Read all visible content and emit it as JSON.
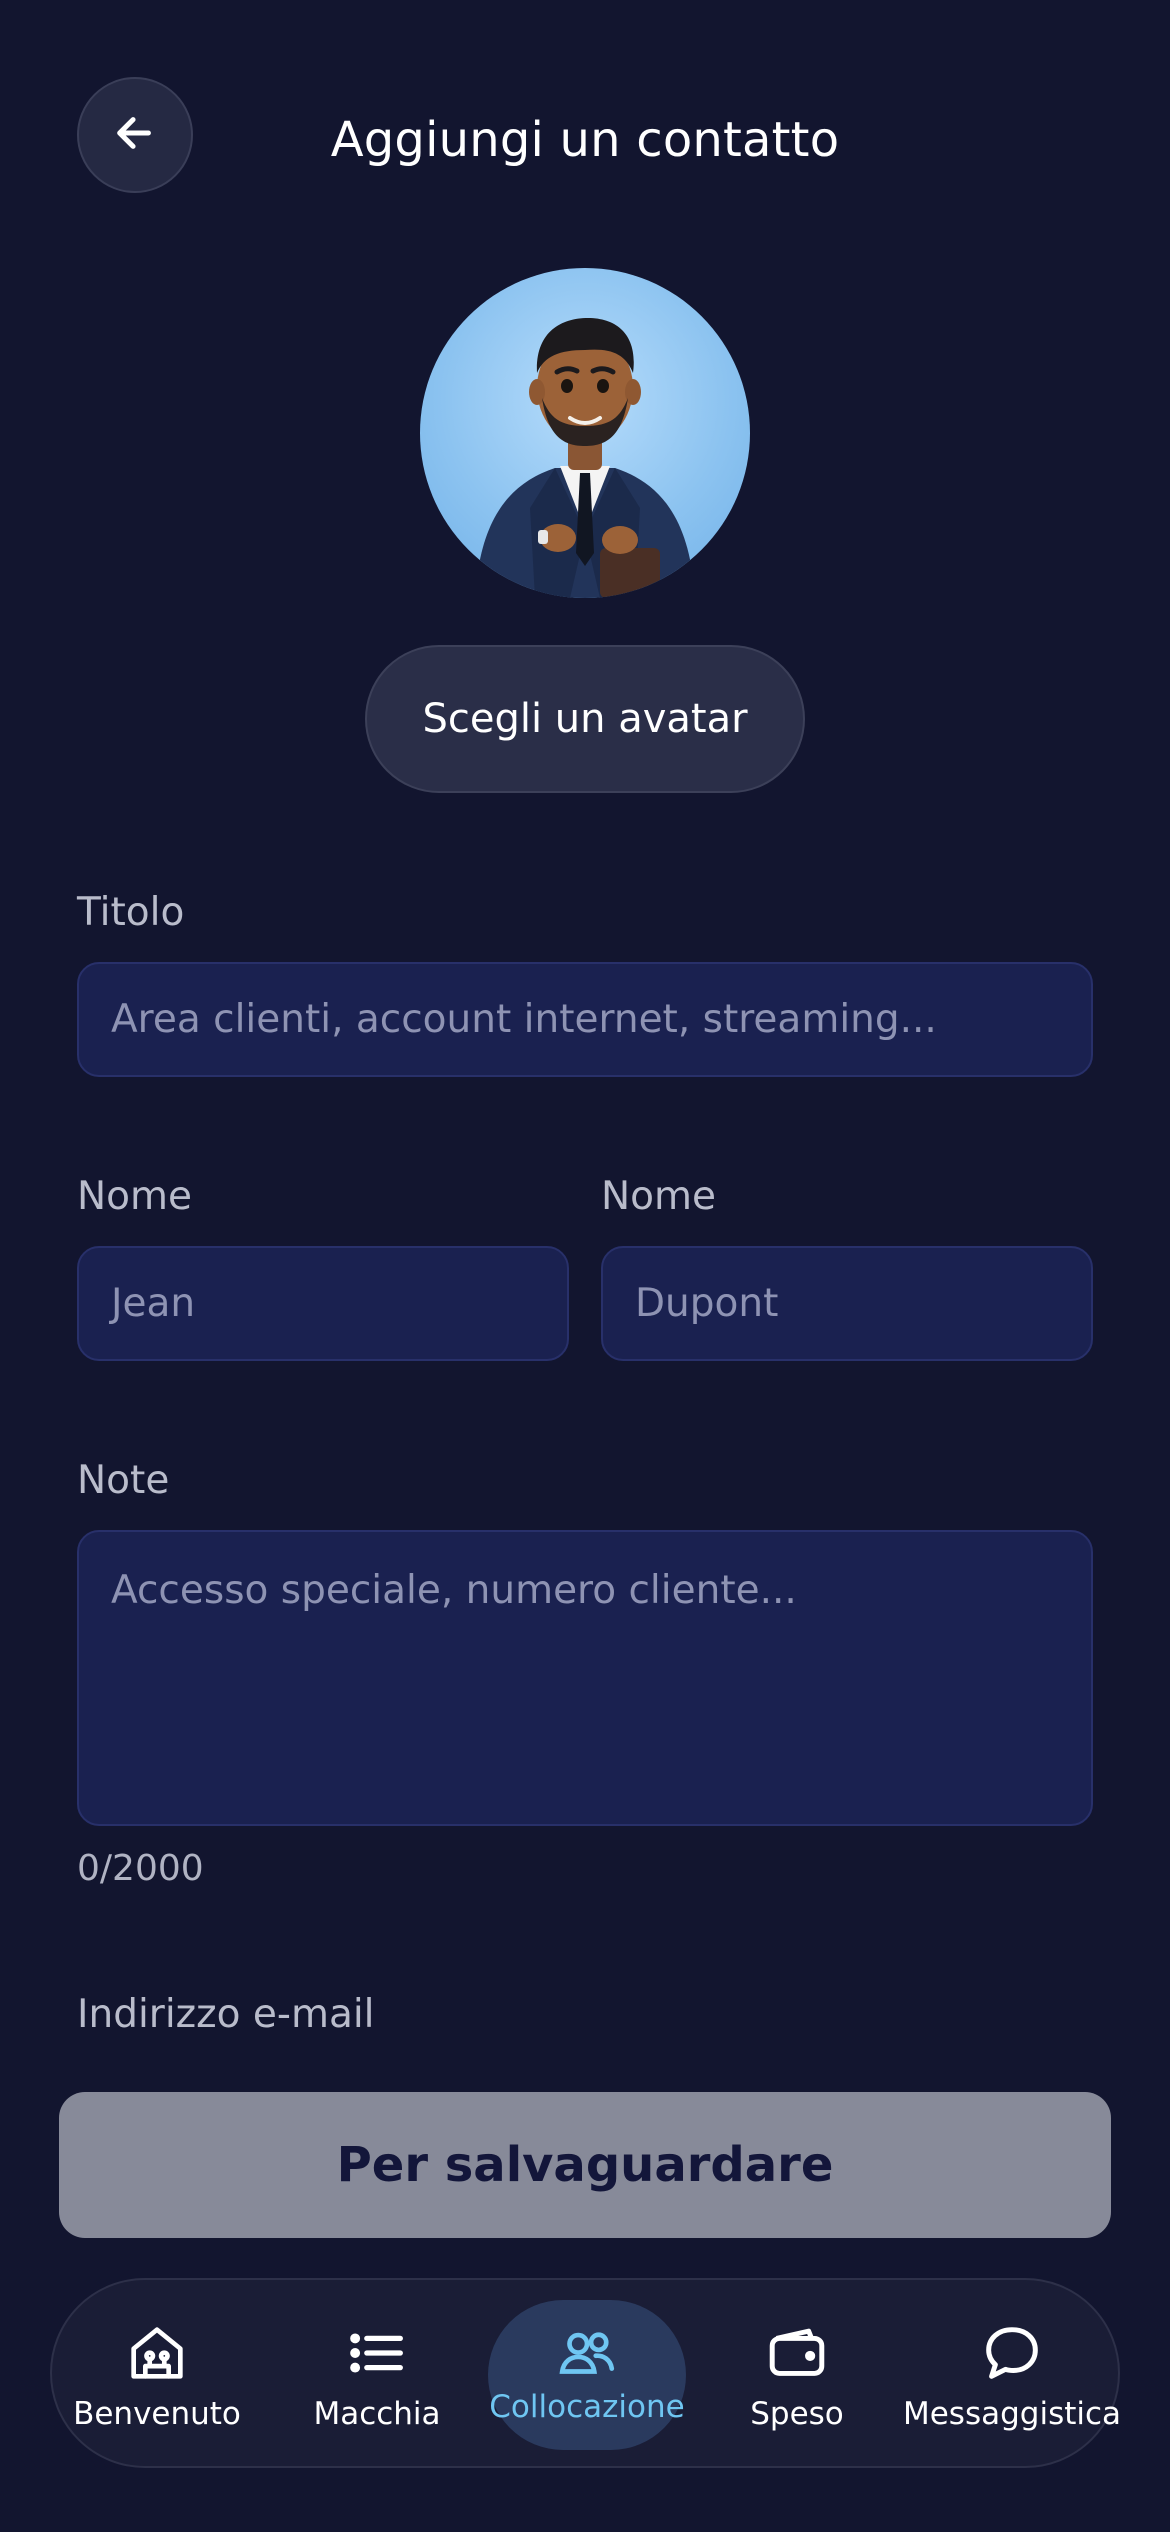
{
  "header": {
    "title": "Aggiungi un contatto",
    "back_icon": "arrow-left-icon"
  },
  "avatar": {
    "button_label": "Scegli un avatar"
  },
  "form": {
    "title_label": "Titolo",
    "title_placeholder": "Area clienti, account internet, streaming...",
    "first_name_label": "Nome",
    "first_name_placeholder": "Jean",
    "last_name_label": "Nome",
    "last_name_placeholder": "Dupont",
    "note_label": "Note",
    "note_placeholder": "Accesso speciale, numero cliente...",
    "note_counter": "0/2000",
    "email_label": "Indirizzo e-mail"
  },
  "save_button": {
    "label": "Per salvaguardare"
  },
  "nav": {
    "items": [
      {
        "label": "Benvenuto",
        "icon": "home-icon"
      },
      {
        "label": "Macchia",
        "icon": "list-icon"
      },
      {
        "label": "Collocazione",
        "icon": "users-icon",
        "active": true
      },
      {
        "label": "Speso",
        "icon": "wallet-icon"
      },
      {
        "label": "Messaggistica",
        "icon": "chat-icon"
      }
    ]
  },
  "colors": {
    "background": "#12152f",
    "input_fill": "#1a2150",
    "active_accent": "#6fc6f2",
    "save_button": "#878a99"
  }
}
